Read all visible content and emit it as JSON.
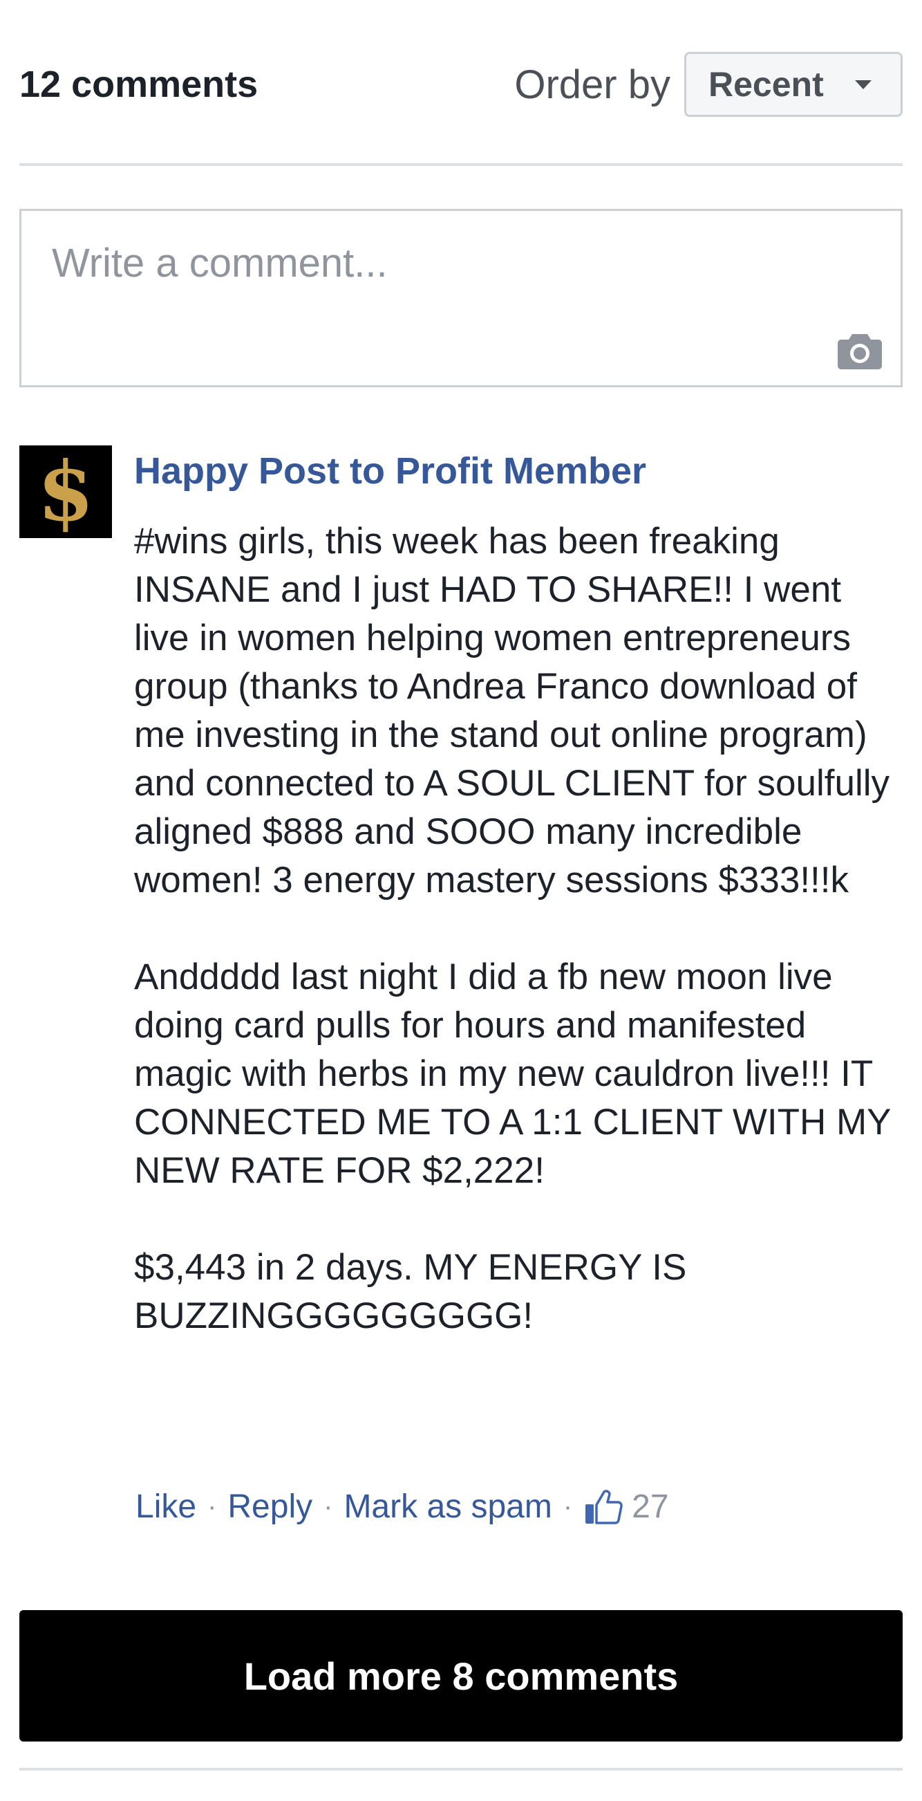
{
  "header": {
    "comment_count": "12 comments",
    "order_label": "Order by",
    "order_value": "Recent"
  },
  "composer": {
    "placeholder": "Write a comment...",
    "camera_icon": "camera-icon"
  },
  "comment": {
    "author": "Happy Post to Profit Member",
    "avatar_glyph": "$",
    "paragraphs": [
      "#wins girls, this week has been freaking INSANE and I just HAD TO SHARE!! I went live in women helping women entrepreneurs group (thanks to Andrea Franco download of me investing in the stand out online program) and connected to A SOUL CLIENT for soulfully aligned $888 and SOOO many incredible women! 3 energy mastery sessions $333!!!k",
      "Anddddd last night I did a fb new moon live doing card pulls for hours and manifested magic with herbs in my new cauldron live!!! IT CONNECTED ME TO A 1:1 CLIENT WITH MY NEW RATE FOR $2,222!",
      "$3,443 in 2 days. MY ENERGY IS BUZZINGGGGGGGGG!"
    ],
    "actions": {
      "like": "Like",
      "reply": "Reply",
      "spam": "Mark as spam",
      "separator": "·",
      "like_count": "27"
    }
  },
  "load_more": "Load more 8 comments",
  "colors": {
    "link": "#365899",
    "button_bg": "#000000",
    "avatar_gold": "#caa14a"
  }
}
